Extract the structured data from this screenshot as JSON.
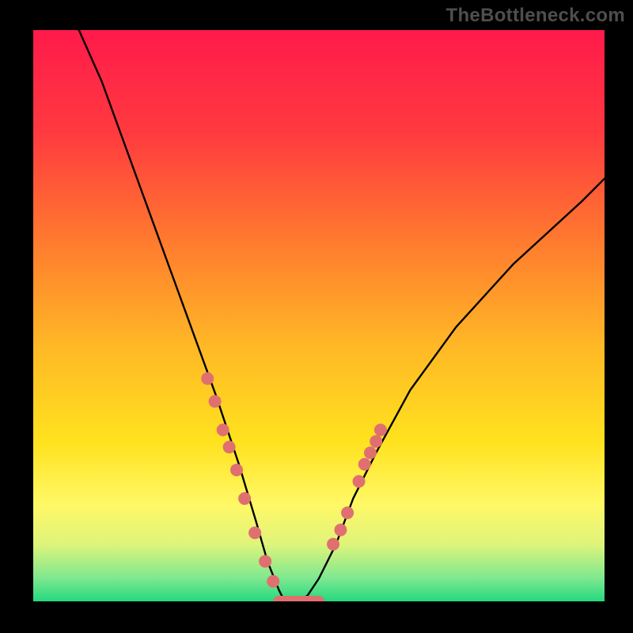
{
  "watermark": "TheBottleneck.com",
  "colors": {
    "gradient_stops": [
      {
        "offset": 0.0,
        "color": "#ff1a4b"
      },
      {
        "offset": 0.18,
        "color": "#ff3a3f"
      },
      {
        "offset": 0.38,
        "color": "#ff7e2e"
      },
      {
        "offset": 0.55,
        "color": "#ffb726"
      },
      {
        "offset": 0.72,
        "color": "#ffe21e"
      },
      {
        "offset": 0.83,
        "color": "#fff866"
      },
      {
        "offset": 0.9,
        "color": "#dff47a"
      },
      {
        "offset": 0.96,
        "color": "#7de890"
      },
      {
        "offset": 1.0,
        "color": "#24d87f"
      }
    ],
    "curve": "#000000",
    "marker_fill": "#e07070",
    "marker_stroke": "#e07070",
    "bottom_band": "#e07070",
    "frame": "#000000"
  },
  "chart_data": {
    "type": "line",
    "title": "",
    "xlabel": "",
    "ylabel": "",
    "xlim": [
      0,
      100
    ],
    "ylim": [
      0,
      100
    ],
    "grid": false,
    "curve": {
      "comment": "V-shaped bottleneck curve; y is high at left, drops to ~0 near x≈44, then rises again to the right. Values are visual estimates of relative height (0 = bottom/green, 100 = top/red).",
      "x": [
        8,
        12,
        16,
        20,
        24,
        28,
        32,
        36,
        39,
        41,
        43,
        44,
        46,
        48,
        50,
        53,
        56,
        60,
        66,
        74,
        84,
        96,
        100
      ],
      "y": [
        100,
        91,
        80,
        69,
        58,
        47,
        36,
        24,
        14,
        7,
        2,
        0,
        0,
        1,
        4,
        10,
        18,
        26,
        37,
        48,
        59,
        70,
        74
      ]
    },
    "markers": {
      "comment": "pink dots overlaid on the lower portion of the curve",
      "points": [
        {
          "x": 30.5,
          "y": 39
        },
        {
          "x": 31.8,
          "y": 35
        },
        {
          "x": 33.2,
          "y": 30
        },
        {
          "x": 34.3,
          "y": 27
        },
        {
          "x": 35.6,
          "y": 23
        },
        {
          "x": 37.0,
          "y": 18
        },
        {
          "x": 38.8,
          "y": 12
        },
        {
          "x": 40.6,
          "y": 7
        },
        {
          "x": 42.0,
          "y": 3.5
        },
        {
          "x": 52.5,
          "y": 10
        },
        {
          "x": 53.8,
          "y": 12.5
        },
        {
          "x": 55.0,
          "y": 15.5
        },
        {
          "x": 57.0,
          "y": 21
        },
        {
          "x": 58.0,
          "y": 24
        },
        {
          "x": 59.0,
          "y": 26
        },
        {
          "x": 60.0,
          "y": 28
        },
        {
          "x": 60.8,
          "y": 30
        }
      ],
      "radius": 8
    },
    "bottom_band": {
      "comment": "thick pink horizontal segment at the trough",
      "x_start": 43,
      "x_end": 50,
      "y": 0,
      "thickness": 14
    }
  }
}
